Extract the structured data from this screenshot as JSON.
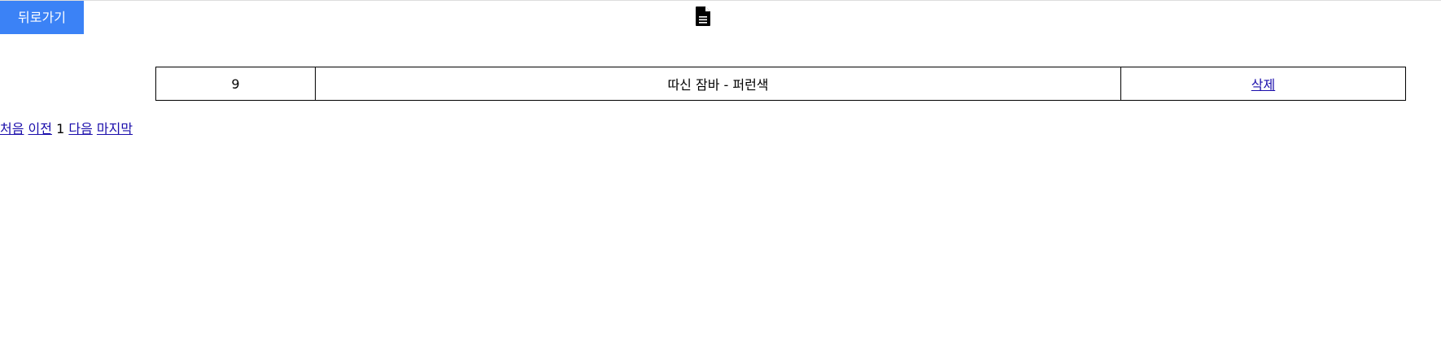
{
  "header": {
    "back_label": "뒤로가기",
    "icon": "document-icon"
  },
  "colors": {
    "back_button_bg": "#3b82f6",
    "link": "#1a0dab"
  },
  "table": {
    "rows": [
      {
        "id": "9",
        "name": "따신 잠바 - 퍼런색",
        "action": "삭제"
      }
    ]
  },
  "pagination": {
    "first": "처음",
    "prev": "이전",
    "current": "1",
    "next": "다음",
    "last": "마지막"
  }
}
